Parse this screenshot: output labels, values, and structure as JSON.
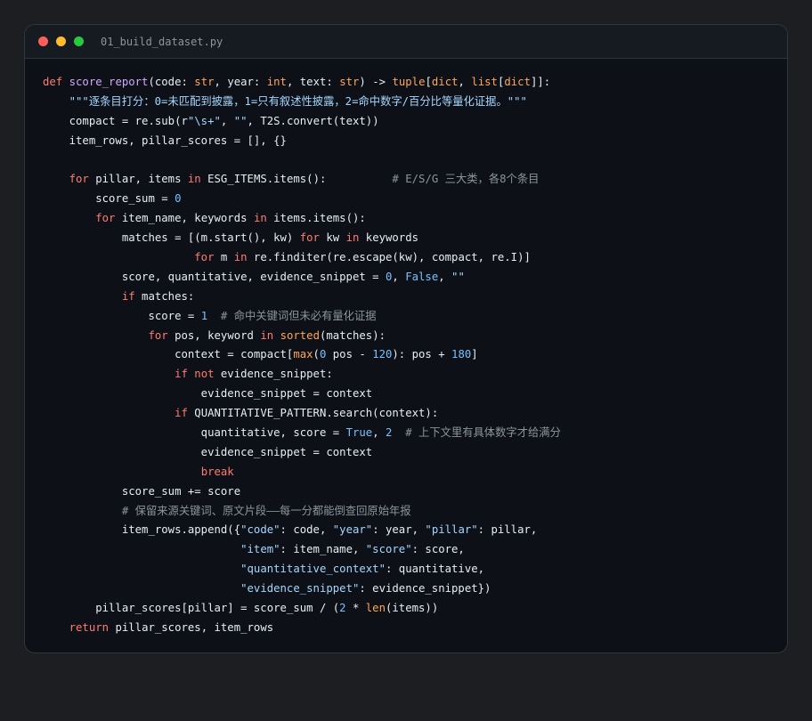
{
  "window": {
    "filename": "01_build_dataset.py",
    "traffic_lights": [
      {
        "name": "close",
        "color": "#ff5f56"
      },
      {
        "name": "minimize",
        "color": "#ffbd2e"
      },
      {
        "name": "maximize",
        "color": "#27c93f"
      }
    ]
  },
  "code_lines": [
    [
      [
        "kw",
        "def "
      ],
      [
        "fn",
        "score_report"
      ],
      [
        "",
        "(code: "
      ],
      [
        "ty",
        "str"
      ],
      [
        "",
        ", year: "
      ],
      [
        "ty",
        "int"
      ],
      [
        "",
        ", text: "
      ],
      [
        "ty",
        "str"
      ],
      [
        "",
        ") -> "
      ],
      [
        "ty",
        "tuple"
      ],
      [
        "",
        "["
      ],
      [
        "ty",
        "dict"
      ],
      [
        "",
        ", "
      ],
      [
        "ty",
        "list"
      ],
      [
        "",
        "["
      ],
      [
        "ty",
        "dict"
      ],
      [
        "",
        "]]:"
      ]
    ],
    [
      [
        "",
        "    "
      ],
      [
        "str",
        "\"\"\"逐条目打分：0=未匹配到披露，1=只有叙述性披露，2=命中数字/百分比等量化证据。\"\"\""
      ]
    ],
    [
      [
        "",
        "    compact = re.sub(r"
      ],
      [
        "str",
        "\"\\s+\""
      ],
      [
        "",
        ", "
      ],
      [
        "str",
        "\"\""
      ],
      [
        "",
        ", T2S.convert(text))"
      ]
    ],
    [
      [
        "",
        "    item_rows, pillar_scores = [], {}"
      ]
    ],
    [
      [
        "",
        ""
      ]
    ],
    [
      [
        "",
        "    "
      ],
      [
        "kw",
        "for"
      ],
      [
        "",
        ", pillar, items "
      ],
      [
        "kw",
        "in"
      ],
      [
        "",
        ", ESG_ITEMS.items():          "
      ],
      [
        "cm",
        "# E/S/G 三大类，各8个条目"
      ]
    ],
    [
      [
        "",
        "        score_sum = "
      ],
      [
        "num",
        "0"
      ]
    ],
    [
      [
        "",
        "        "
      ],
      [
        "kw",
        "for"
      ],
      [
        "",
        ", item_name, keywords "
      ],
      [
        "kw",
        "in"
      ],
      [
        "",
        ", items.items():"
      ]
    ],
    [
      [
        "",
        "            matches = [(m.start(), kw) "
      ],
      [
        "kw",
        "for"
      ],
      [
        "",
        ", kw "
      ],
      [
        "kw",
        "in"
      ],
      [
        "",
        ", keywords"
      ]
    ],
    [
      [
        "",
        "                       "
      ],
      [
        "kw",
        "for"
      ],
      [
        "",
        ", m "
      ],
      [
        "kw",
        "in"
      ],
      [
        "",
        ", re.finditer(re.escape(kw), compact, re.I)]"
      ]
    ],
    [
      [
        "",
        "            score, quantitative, evidence_snippet = "
      ],
      [
        "num",
        "0"
      ],
      [
        "",
        ", "
      ],
      [
        "num",
        "False"
      ],
      [
        "",
        ", "
      ],
      [
        "str",
        "\"\""
      ]
    ],
    [
      [
        "",
        "            "
      ],
      [
        "kw",
        "if"
      ],
      [
        "",
        ", matches:"
      ]
    ],
    [
      [
        "",
        "                score = "
      ],
      [
        "num",
        "1"
      ],
      [
        "",
        "  "
      ],
      [
        "cm",
        "# 命中关键词但未必有量化证据"
      ]
    ],
    [
      [
        "",
        "                "
      ],
      [
        "kw",
        "for"
      ],
      [
        "",
        ", pos, keyword "
      ],
      [
        "kw",
        "in"
      ],
      [
        "",
        ", "
      ],
      [
        "ty",
        "sorted"
      ],
      [
        "",
        "(matches):"
      ]
    ],
    [
      [
        "",
        "                    context = compact["
      ],
      [
        "ty",
        "max"
      ],
      [
        "",
        "("
      ],
      [
        "num",
        "0"
      ],
      [
        "",
        ", pos - "
      ],
      [
        "num",
        "120"
      ],
      [
        "",
        "): pos + "
      ],
      [
        "num",
        "180"
      ],
      [
        "",
        "]"
      ]
    ],
    [
      [
        "",
        "                    "
      ],
      [
        "kw",
        "if not"
      ],
      [
        "",
        ", evidence_snippet:"
      ]
    ],
    [
      [
        "",
        "                        evidence_snippet = context"
      ]
    ],
    [
      [
        "",
        "                    "
      ],
      [
        "kw",
        "if"
      ],
      [
        "",
        ", QUANTITATIVE_PATTERN.search(context):"
      ]
    ],
    [
      [
        "",
        "                        quantitative, score = "
      ],
      [
        "num",
        "True"
      ],
      [
        "",
        ", "
      ],
      [
        "num",
        "2"
      ],
      [
        "",
        "  "
      ],
      [
        "cm",
        "# 上下文里有具体数字才给满分"
      ]
    ],
    [
      [
        "",
        "                        evidence_snippet = context"
      ]
    ],
    [
      [
        "",
        "                        "
      ],
      [
        "kw",
        "break"
      ]
    ],
    [
      [
        "",
        "            score_sum += score"
      ]
    ],
    [
      [
        "",
        "            "
      ],
      [
        "cm",
        "# 保留来源关键词、原文片段——每一分都能倒查回原始年报"
      ]
    ],
    [
      [
        "",
        "            item_rows.append({"
      ],
      [
        "str",
        "\"code\""
      ],
      [
        "",
        ": code, "
      ],
      [
        "str",
        "\"year\""
      ],
      [
        "",
        ": year, "
      ],
      [
        "str",
        "\"pillar\""
      ],
      [
        "",
        ": pillar,"
      ]
    ],
    [
      [
        "",
        "                              "
      ],
      [
        "str",
        "\"item\""
      ],
      [
        "",
        ": item_name, "
      ],
      [
        "str",
        "\"score\""
      ],
      [
        "",
        ": score,"
      ]
    ],
    [
      [
        "",
        "                              "
      ],
      [
        "str",
        "\"quantitative_context\""
      ],
      [
        "",
        ": quantitative,"
      ]
    ],
    [
      [
        "",
        "                              "
      ],
      [
        "str",
        "\"evidence_snippet\""
      ],
      [
        "",
        ": evidence_snippet})"
      ]
    ],
    [
      [
        "",
        "        pillar_scores[pillar] = score_sum / ("
      ],
      [
        "num",
        "2"
      ],
      [
        "",
        ", * "
      ],
      [
        "ty",
        "len"
      ],
      [
        "",
        "(items))"
      ]
    ],
    [
      [
        "",
        "    "
      ],
      [
        "kw",
        "return"
      ],
      [
        "",
        ", pillar_scores, item_rows"
      ]
    ]
  ]
}
